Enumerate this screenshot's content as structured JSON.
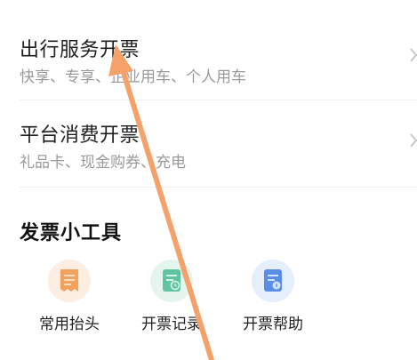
{
  "entries": [
    {
      "title": "出行服务开票",
      "subtitle": "快享、专享、企业用车、个人用车"
    },
    {
      "title": "平台消费开票",
      "subtitle": "礼品卡、现金购券、充电"
    }
  ],
  "tools_section": {
    "title": "发票小工具",
    "items": [
      {
        "label": "常用抬头",
        "icon": "receipt-icon",
        "color": "#f2a25c",
        "bg": "#fdeee2"
      },
      {
        "label": "开票记录",
        "icon": "record-icon",
        "color": "#5fc4a2",
        "bg": "#e4f5ee"
      },
      {
        "label": "开票帮助",
        "icon": "help-doc-icon",
        "color": "#5b8ee6",
        "bg": "#e5eefb"
      }
    ]
  },
  "colors": {
    "annotation_arrow": "#f4a26a"
  }
}
